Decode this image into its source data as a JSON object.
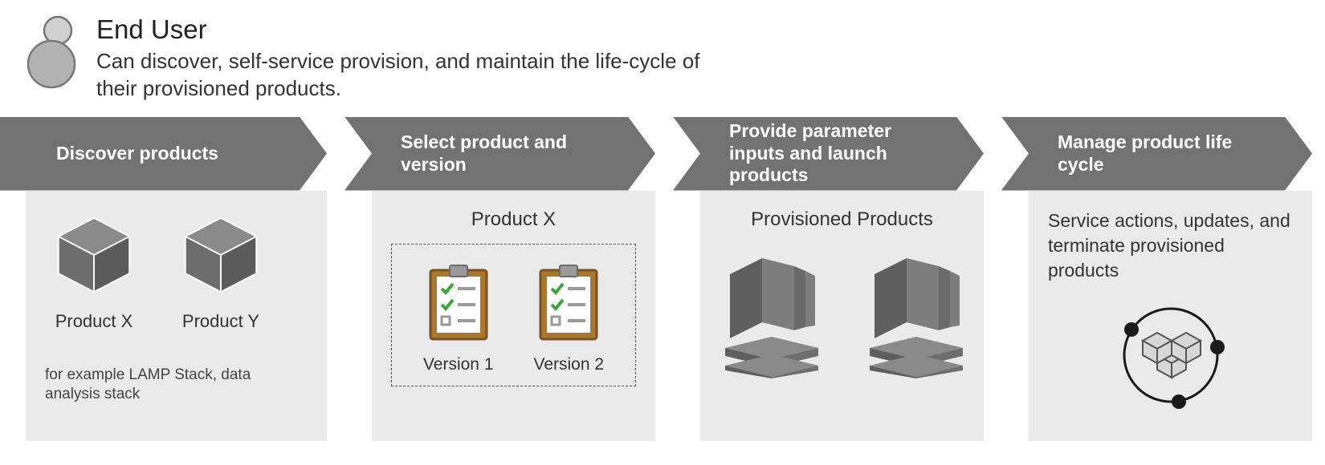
{
  "header": {
    "title": "End User",
    "subtitle": "Can discover, self-service provision, and maintain the life-cycle of their provisioned products."
  },
  "steps": [
    {
      "arrow_label": "Discover products",
      "products": [
        "Product X",
        "Product Y"
      ],
      "caption": "for example LAMP Stack, data analysis stack"
    },
    {
      "arrow_label": "Select product and version",
      "selected_product": "Product X",
      "versions": [
        "Version 1",
        "Version 2"
      ]
    },
    {
      "arrow_label": "Provide parameter inputs and launch products",
      "content_title": "Provisioned Products"
    },
    {
      "arrow_label": "Manage product life cycle",
      "content_text": "Service actions, updates, and terminate provisioned products"
    }
  ]
}
